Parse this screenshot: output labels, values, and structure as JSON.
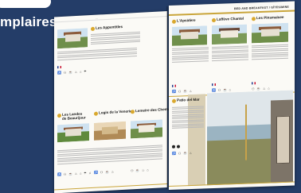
{
  "headline": "mplaires",
  "left_page": {
    "entries": [
      {
        "name_line1": "Les Appentitles",
        "name_line2": ""
      },
      {
        "name_line1": "Les Landes",
        "name_line2": "de Beaurijour"
      },
      {
        "name_line1": "Logis de la Venerie",
        "name_line2": ""
      },
      {
        "name_line1": "Lemeire des Chemes",
        "name_line2": ""
      }
    ]
  },
  "right_page": {
    "header": "BED AND BREAKFAST / GÎTES/MINE",
    "entries": [
      {
        "name_line1": "L'Apsidère",
        "name_line2": ""
      },
      {
        "name_line1": "Laffève Chantel",
        "name_line2": ""
      },
      {
        "name_line1": "Les Pinsmaisee",
        "name_line2": ""
      },
      {
        "name_line1": "Patio del Mar",
        "name_line2": ""
      }
    ]
  }
}
